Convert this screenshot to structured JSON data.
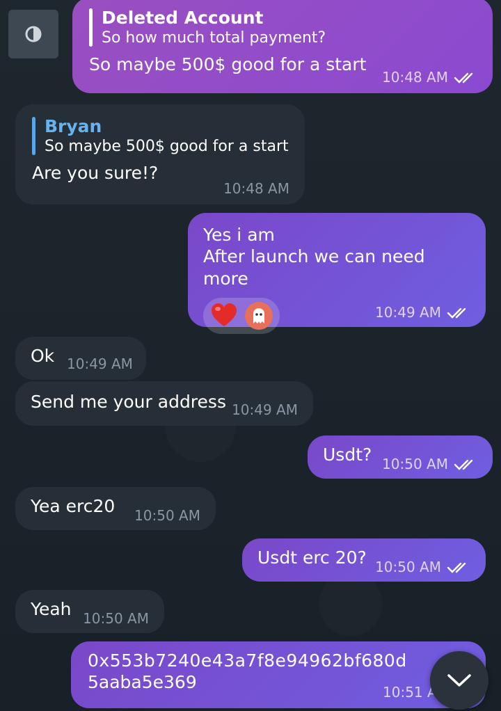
{
  "messages": [
    {
      "reply_name": "Deleted Account",
      "reply_text": "So how much total payment?",
      "text": "So maybe 500$ good for a start",
      "time": "10:48 AM"
    },
    {
      "reply_name": "Bryan",
      "reply_text": "So maybe 500$ good for a start",
      "text": "Are you sure!?",
      "time": "10:48 AM"
    },
    {
      "line1": "Yes i am",
      "line2": "After launch we can need more",
      "time": "10:49 AM"
    },
    {
      "text": "Ok",
      "time": "10:49 AM"
    },
    {
      "text": "Send me your address",
      "time": "10:49 AM"
    },
    {
      "text": "Usdt?",
      "time": "10:50 AM"
    },
    {
      "text": "Yea erc20",
      "time": "10:50 AM"
    },
    {
      "text": "Usdt erc 20?",
      "time": "10:50 AM"
    },
    {
      "text": "Yeah",
      "time": "10:50 AM"
    },
    {
      "line1": "0x553b7240e43a7f8e94962bf680d",
      "line2": "5aaba5e369",
      "time": "10:51 A"
    }
  ],
  "reactions": [
    "heart-emoji",
    "ghost-emoji"
  ],
  "icons": {
    "theme_toggle": "contrast-icon",
    "scroll_down": "chevron-down-icon",
    "read_receipt": "double-check-icon"
  },
  "colors": {
    "outgoing_bubble": "#7a48c9",
    "incoming_bubble": "#262f38",
    "reply_name_incoming": "#68b2ee",
    "background": "#1a2129"
  }
}
